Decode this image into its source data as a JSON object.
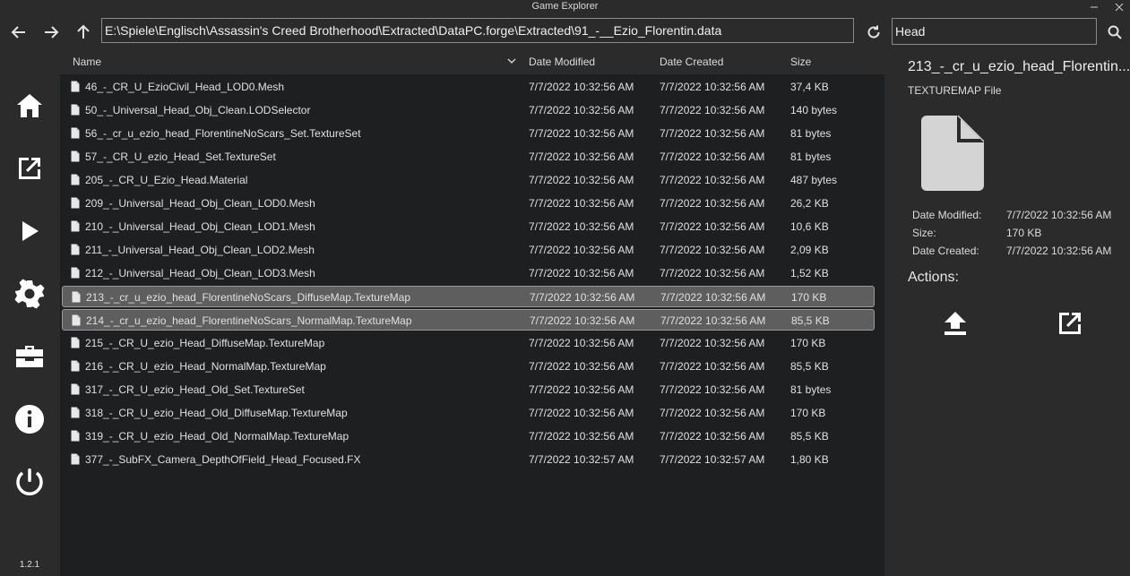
{
  "window": {
    "title": "Game Explorer"
  },
  "toolbar": {
    "path": "E:\\Spiele\\Englisch\\Assassin's Creed Brotherhood\\Extracted\\DataPC.forge\\Extracted\\91_-__Ezio_Florentin.data",
    "search": "Head"
  },
  "columns": {
    "name": "Name",
    "date_modified": "Date Modified",
    "date_created": "Date Created",
    "size": "Size"
  },
  "files": [
    {
      "name": "46_-_CR_U_EzioCivil_Head_LOD0.Mesh",
      "modified": "7/7/2022 10:32:56 AM",
      "created": "7/7/2022 10:32:56 AM",
      "size": "37,4 KB",
      "selected": false
    },
    {
      "name": "50_-_Universal_Head_Obj_Clean.LODSelector",
      "modified": "7/7/2022 10:32:56 AM",
      "created": "7/7/2022 10:32:56 AM",
      "size": "140 bytes",
      "selected": false
    },
    {
      "name": "56_-_cr_u_ezio_head_FlorentineNoScars_Set.TextureSet",
      "modified": "7/7/2022 10:32:56 AM",
      "created": "7/7/2022 10:32:56 AM",
      "size": "81 bytes",
      "selected": false
    },
    {
      "name": "57_-_CR_U_ezio_Head_Set.TextureSet",
      "modified": "7/7/2022 10:32:56 AM",
      "created": "7/7/2022 10:32:56 AM",
      "size": "81 bytes",
      "selected": false
    },
    {
      "name": "205_-_CR_U_Ezio_Head.Material",
      "modified": "7/7/2022 10:32:56 AM",
      "created": "7/7/2022 10:32:56 AM",
      "size": "487 bytes",
      "selected": false
    },
    {
      "name": "209_-_Universal_Head_Obj_Clean_LOD0.Mesh",
      "modified": "7/7/2022 10:32:56 AM",
      "created": "7/7/2022 10:32:56 AM",
      "size": "26,2 KB",
      "selected": false
    },
    {
      "name": "210_-_Universal_Head_Obj_Clean_LOD1.Mesh",
      "modified": "7/7/2022 10:32:56 AM",
      "created": "7/7/2022 10:32:56 AM",
      "size": "10,6 KB",
      "selected": false
    },
    {
      "name": "211_-_Universal_Head_Obj_Clean_LOD2.Mesh",
      "modified": "7/7/2022 10:32:56 AM",
      "created": "7/7/2022 10:32:56 AM",
      "size": "2,09 KB",
      "selected": false
    },
    {
      "name": "212_-_Universal_Head_Obj_Clean_LOD3.Mesh",
      "modified": "7/7/2022 10:32:56 AM",
      "created": "7/7/2022 10:32:56 AM",
      "size": "1,52 KB",
      "selected": false
    },
    {
      "name": "213_-_cr_u_ezio_head_FlorentineNoScars_DiffuseMap.TextureMap",
      "modified": "7/7/2022 10:32:56 AM",
      "created": "7/7/2022 10:32:56 AM",
      "size": "170 KB",
      "selected": true
    },
    {
      "name": "214_-_cr_u_ezio_head_FlorentineNoScars_NormalMap.TextureMap",
      "modified": "7/7/2022 10:32:56 AM",
      "created": "7/7/2022 10:32:56 AM",
      "size": "85,5 KB",
      "selected": true
    },
    {
      "name": "215_-_CR_U_ezio_Head_DiffuseMap.TextureMap",
      "modified": "7/7/2022 10:32:56 AM",
      "created": "7/7/2022 10:32:56 AM",
      "size": "170 KB",
      "selected": false
    },
    {
      "name": "216_-_CR_U_ezio_Head_NormalMap.TextureMap",
      "modified": "7/7/2022 10:32:56 AM",
      "created": "7/7/2022 10:32:56 AM",
      "size": "85,5 KB",
      "selected": false
    },
    {
      "name": "317_-_CR_U_ezio_Head_Old_Set.TextureSet",
      "modified": "7/7/2022 10:32:56 AM",
      "created": "7/7/2022 10:32:56 AM",
      "size": "81 bytes",
      "selected": false
    },
    {
      "name": "318_-_CR_U_ezio_Head_Old_DiffuseMap.TextureMap",
      "modified": "7/7/2022 10:32:56 AM",
      "created": "7/7/2022 10:32:56 AM",
      "size": "170 KB",
      "selected": false
    },
    {
      "name": "319_-_CR_U_ezio_Head_Old_NormalMap.TextureMap",
      "modified": "7/7/2022 10:32:56 AM",
      "created": "7/7/2022 10:32:56 AM",
      "size": "85,5 KB",
      "selected": false
    },
    {
      "name": "377_-_SubFX_Camera_DepthOfField_Head_Focused.FX",
      "modified": "7/7/2022 10:32:57 AM",
      "created": "7/7/2022 10:32:57 AM",
      "size": "1,80 KB",
      "selected": false
    }
  ],
  "details": {
    "name": "213_-_cr_u_ezio_head_Florentin...",
    "type": "TEXTUREMAP File",
    "date_modified_label": "Date Modified:",
    "date_modified": "7/7/2022 10:32:56 AM",
    "size_label": "Size:",
    "size": "170 KB",
    "date_created_label": "Date Created:",
    "date_created": "7/7/2022 10:32:56 AM",
    "actions_label": "Actions:"
  },
  "sidebar": {
    "items": [
      "home-icon",
      "open-external-icon",
      "play-icon",
      "settings-gear-icon",
      "toolbox-icon",
      "info-icon",
      "power-icon"
    ],
    "version": "1.2.1"
  },
  "colors": {
    "background": "#2b2b2b",
    "list_background": "#1e1f21",
    "selection": "#5e5e5e"
  }
}
